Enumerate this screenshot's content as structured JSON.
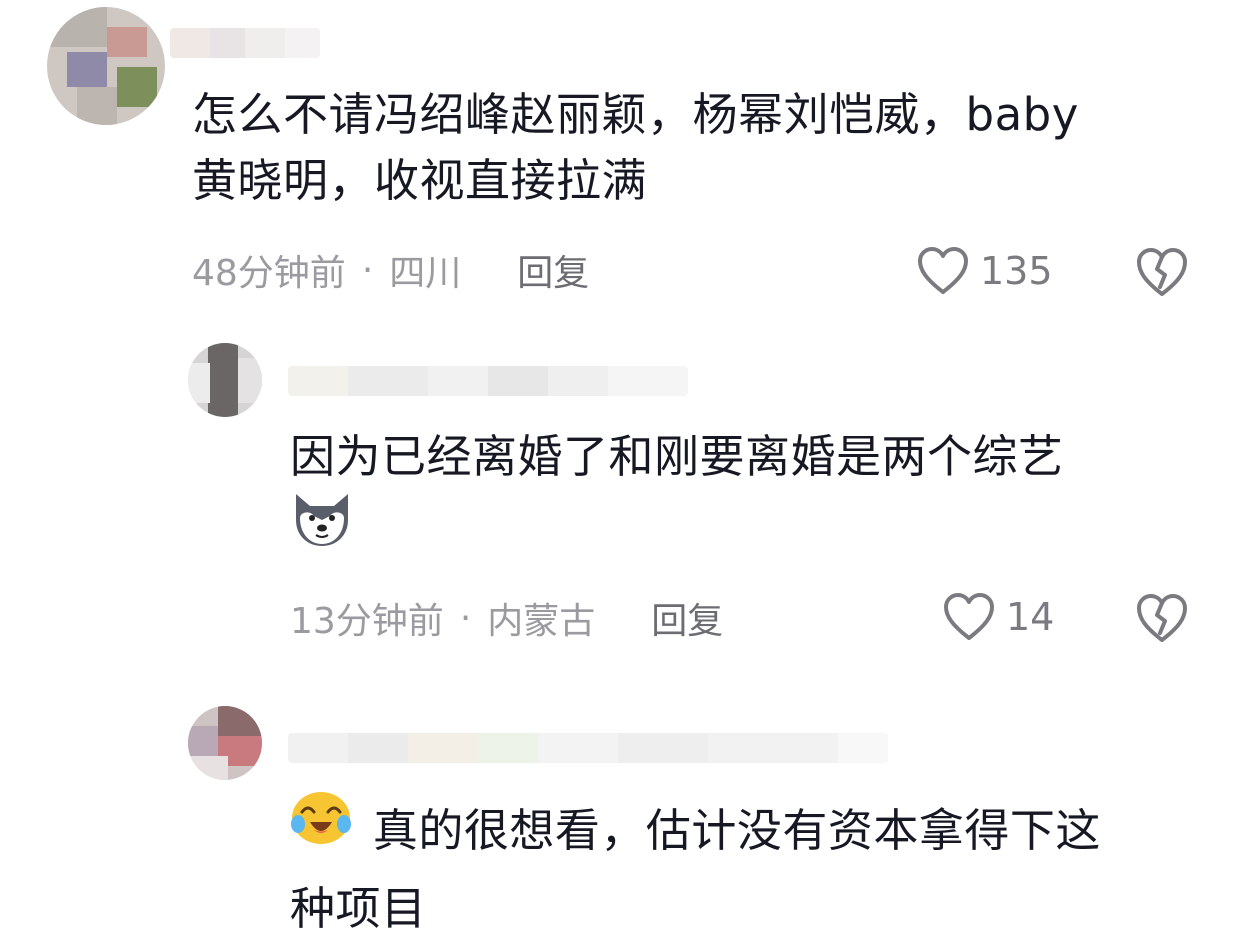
{
  "comments": [
    {
      "text_lines": [
        "怎么不请冯绍峰赵丽颖，杨幂刘恺威，baby",
        "黄晓明，收视直接拉满"
      ],
      "time": "48分钟前",
      "separator": "·",
      "location": "四川",
      "reply_label": "回复",
      "like_count": "135"
    },
    {
      "text_lines": [
        "因为已经离婚了和刚要离婚是两个综艺"
      ],
      "emoji": "husky-emoji",
      "time": "13分钟前",
      "separator": "·",
      "location": "内蒙古",
      "reply_label": "回复",
      "like_count": "14"
    },
    {
      "text_lines": [
        "真的很想看，估计没有资本拿得下这",
        "种项目"
      ],
      "emoji": "crying-laugh-emoji"
    }
  ],
  "icons": {
    "like": "heart-outline-icon",
    "dislike": "broken-heart-icon"
  },
  "colors": {
    "text": "#161823",
    "meta": "#9a9aa0",
    "reply": "#6c6c72",
    "icon": "#7a7a80"
  }
}
